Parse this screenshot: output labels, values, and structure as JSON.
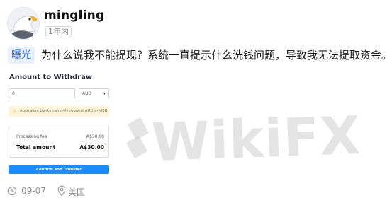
{
  "post": {
    "username": "mingling",
    "time_badge": "1年内",
    "tag": "曝光",
    "text": "为什么说我不能提现？系统一直提示什么洗钱问题，导致我无法提取资金。",
    "date": "09-07",
    "location": "美国"
  },
  "screenshot": {
    "title": "Amount to Withdraw",
    "amount_value": "0",
    "currency": "AUD",
    "notice": "Australian banks can only request AUD or USD",
    "fee_label": "Processing fee",
    "fee_value": "A$30.00",
    "total_label": "Total amount",
    "total_value": "A$30.00",
    "confirm_label": "Confirm and Transfer"
  },
  "watermark": {
    "text": "WikiFX"
  },
  "icons": {
    "clock": "clock-icon",
    "pin": "location-pin-icon",
    "warning": "warning-icon",
    "caret": "chevron-down-icon"
  },
  "colors": {
    "tag_bg": "#e7f0ff",
    "tag_text": "#2f6ae0",
    "confirm_button": "#1a8cff",
    "notice_bg": "#fdf4dd"
  }
}
